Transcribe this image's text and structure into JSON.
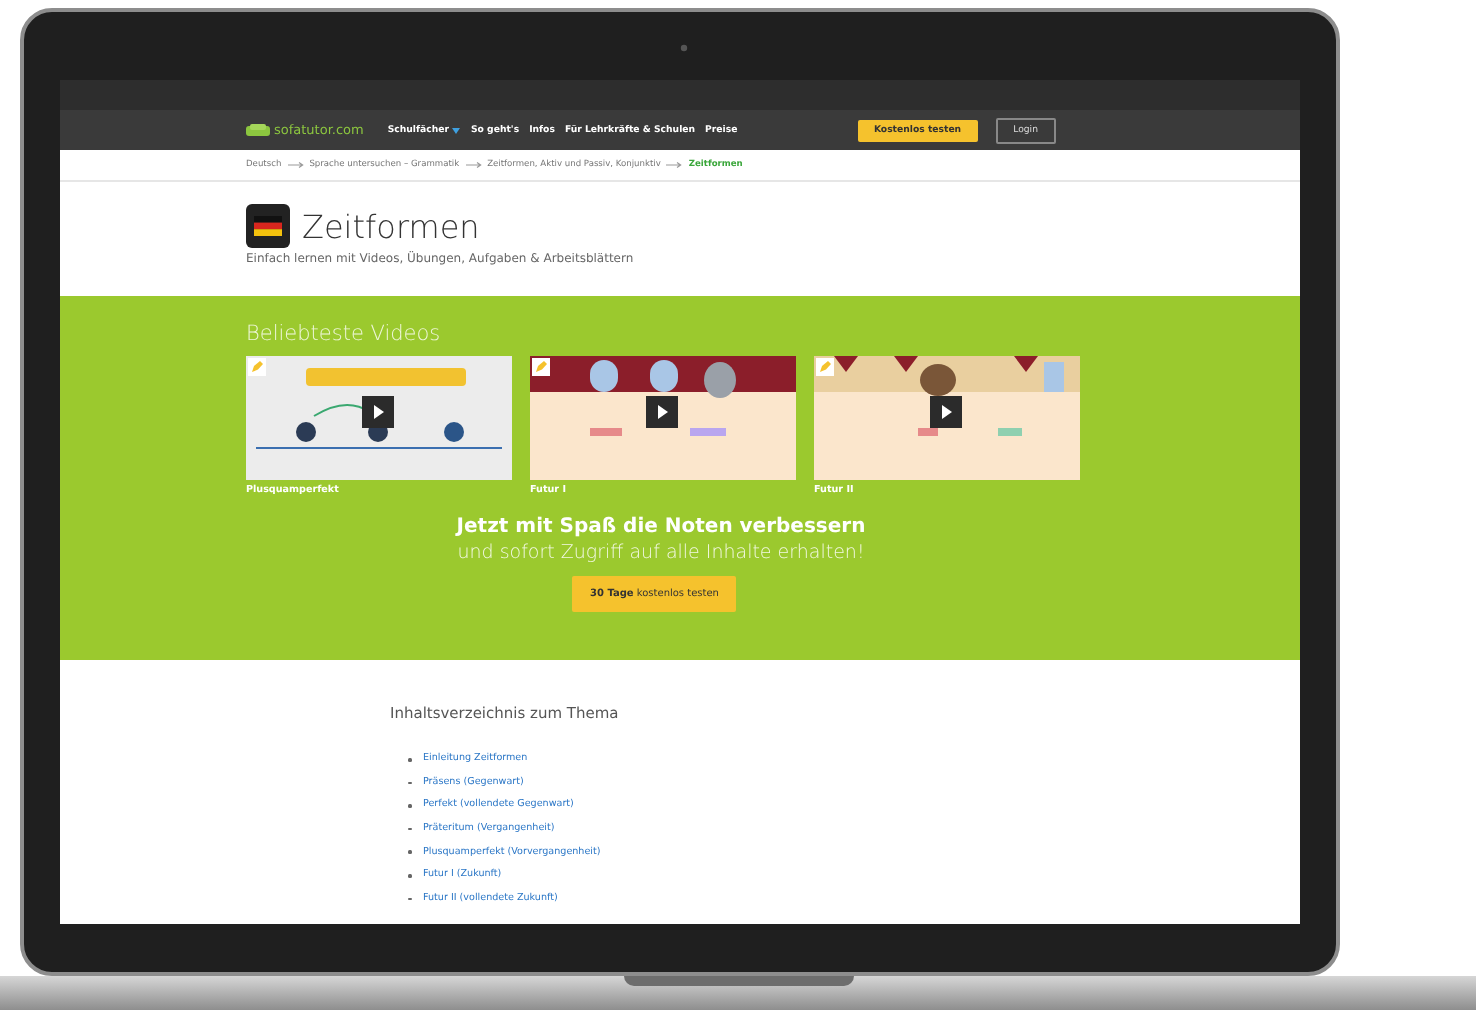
{
  "nav": {
    "logo": "sofatutor.com",
    "items": [
      {
        "label": "Schulfächer",
        "dropdown": true
      },
      {
        "label": "So geht's",
        "dropdown": false
      },
      {
        "label": "Infos",
        "dropdown": false
      },
      {
        "label": "Für Lehrkräfte & Schulen",
        "dropdown": false
      },
      {
        "label": "Preise",
        "dropdown": false
      }
    ],
    "trial_button": "Kostenlos testen",
    "login_button": "Login"
  },
  "breadcrumb": [
    {
      "label": "Deutsch",
      "current": false
    },
    {
      "label": "Sprache untersuchen – Grammatik",
      "current": false
    },
    {
      "label": "Zeitformen, Aktiv und Passiv, Konjunktiv",
      "current": false
    },
    {
      "label": "Zeitformen",
      "current": true
    }
  ],
  "header": {
    "title": "Zeitformen",
    "subtitle": "Einfach lernen mit Videos, Übungen, Aufgaben & Arbeitsblättern"
  },
  "videos": {
    "heading": "Beliebteste Videos",
    "items": [
      {
        "kind": "diagram",
        "title": "Plusquamperfekt"
      },
      {
        "kind": "stage",
        "title": "Futur I"
      },
      {
        "kind": "castle",
        "title": "Futur II"
      }
    ]
  },
  "promo": {
    "headline": "Jetzt mit Spaß die Noten verbessern",
    "subline": "und sofort Zugriff auf alle Inhalte erhalten!",
    "button": "**30 Tage** kostenlos testen"
  },
  "toc": {
    "heading": "Inhaltsverzeichnis zum Thema",
    "items": [
      "Einleitung Zeitformen",
      "Präsens (Gegenwart)",
      "Perfekt (vollendete Gegenwart)",
      "Präteritum (Vergangenheit)",
      "Plusquamperfekt (Vorvergangenheit)",
      "Futur I (Zukunft)",
      "Futur II (vollendete Zukunft)"
    ]
  }
}
